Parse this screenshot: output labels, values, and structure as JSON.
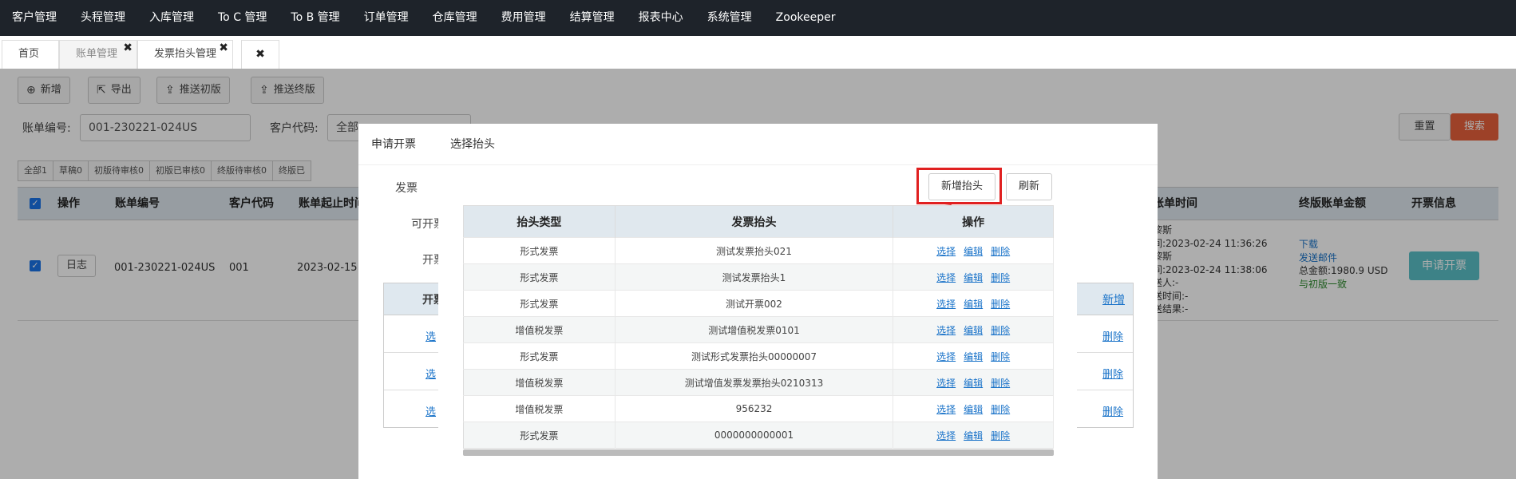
{
  "topnav": {
    "items": [
      "客户管理",
      "头程管理",
      "入库管理",
      "To C 管理",
      "To B 管理",
      "订单管理",
      "仓库管理",
      "费用管理",
      "结算管理",
      "报表中心",
      "系统管理",
      "Zookeeper"
    ]
  },
  "tabs": [
    {
      "label": "首页"
    },
    {
      "label": "账单管理"
    },
    {
      "label": "发票抬头管理"
    }
  ],
  "tab_close": "✖",
  "toolbar": {
    "add": "新增",
    "export": "导出",
    "push_first": "推送初版",
    "push_final": "推送终版"
  },
  "filters": {
    "bill_no_label": "账单编号:",
    "bill_no_value": "001-230221-024US",
    "customer_code_label": "客户代码:",
    "customer_code_value": "全部",
    "reset": "重置",
    "search": "搜索"
  },
  "status_tabs": [
    "全部1",
    "草稿0",
    "初版待审核0",
    "初版已审核0",
    "终版待审核0",
    "终版已"
  ],
  "table": {
    "headers": [
      "操作",
      "账单编号",
      "客户代码",
      "账单起止时间",
      "账单时间",
      "终版账单金额",
      "开票信息"
    ],
    "row": {
      "log_button": "日志",
      "bill_no": "001-230221-024US",
      "customer_code": "001",
      "period": "2023-02-15 ~",
      "time_lines": [
        "黎斯",
        "间:2023-02-24 11:36:26",
        "黎斯",
        "间:2023-02-24 11:38:06",
        "送人:-",
        "送时间:-",
        "送结果:-"
      ],
      "download": "下载",
      "send_email": "发送邮件",
      "total": "总金额:1980.9 USD",
      "consistent": "与初版一致",
      "apply": "申请开票"
    }
  },
  "dialog_apply": {
    "title": "申请开票",
    "labels": [
      "发票",
      "可开票",
      "开票"
    ],
    "sub_header": "开票",
    "links": [
      "选",
      "选",
      "选"
    ],
    "add_link": "新增",
    "delete_links": [
      "删除",
      "删除",
      "删除"
    ]
  },
  "dialog_select": {
    "title": "选择抬头",
    "add_button": "新增抬头",
    "refresh_button": "刷新",
    "headers": [
      "抬头类型",
      "发票抬头",
      "操作"
    ],
    "actions": [
      "选择",
      "编辑",
      "删除"
    ],
    "rows": [
      {
        "type": "形式发票",
        "title": "测试发票抬头021"
      },
      {
        "type": "形式发票",
        "title": "测试发票抬头1"
      },
      {
        "type": "形式发票",
        "title": "测试开票002"
      },
      {
        "type": "增值税发票",
        "title": "测试增值税发票0101"
      },
      {
        "type": "形式发票",
        "title": "测试形式发票抬头00000007"
      },
      {
        "type": "增值税发票",
        "title": "测试增值发票发票抬头0210313"
      },
      {
        "type": "增值税发票",
        "title": "956232"
      },
      {
        "type": "形式发票",
        "title": "0000000000001"
      }
    ]
  },
  "colors": {
    "nav_bg": "#1e232a",
    "search_btn": "#e8603c",
    "apply_btn": "#5bc0c8",
    "highlight": "#e02020",
    "link": "#1a73c9"
  }
}
